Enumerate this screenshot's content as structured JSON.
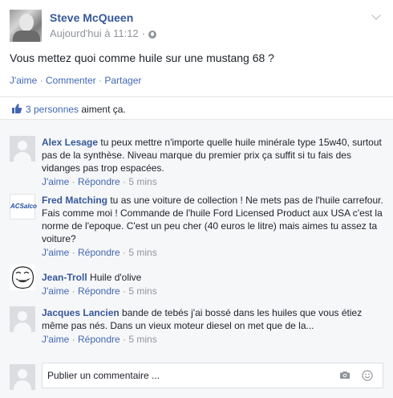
{
  "post": {
    "author": "Steve McQueen",
    "timestamp": "Aujourd'hui à 11:12",
    "separator": "·",
    "text": "Vous mettez quoi comme huile sur une mustang 68 ?",
    "actions": {
      "like": "J'aime",
      "comment": "Commenter",
      "share": "Partager",
      "sep": " · "
    },
    "likes": {
      "count_link": "3 personnes",
      "suffix": " aiment ça."
    }
  },
  "comments": [
    {
      "author": "Alex Lesage",
      "text": " tu peux mettre n'importe quelle huile minérale type 15w40, surtout pas de la synthèse. Niveau marque du premier prix ça suffit si tu fais des vidanges pas trop espacées.",
      "like": "J'aime",
      "reply": "Répondre",
      "time": "5 mins",
      "avatar": "default-avatar"
    },
    {
      "author": "Fred Matching",
      "text": " tu as une voiture de collection ! Ne mets pas de l'huile carrefour. Fais comme moi ! Commande de l'huile Ford Licensed Product aux USA c'est la norme de l'epoque. C'est un peu cher (40 euros le litre) mais aimes tu assez ta voiture?",
      "like": "J'aime",
      "reply": "Répondre",
      "time": "5 mins",
      "avatar": "logo-avatar",
      "avatar_label": "ACSalco"
    },
    {
      "author": "Jean-Troll",
      "text": " Huile d'olive",
      "like": "J'aime",
      "reply": "Répondre",
      "time": "5 mins",
      "avatar": "troll-face-avatar"
    },
    {
      "author": "Jacques Lancien",
      "text": " bande de tebés j'ai bossé dans les huiles que vous étiez même pas nés. Dans un vieux moteur diesel on met que de la...",
      "like": "J'aime",
      "reply": "Répondre",
      "time": "5 mins",
      "avatar": "default-avatar"
    }
  ],
  "composer": {
    "placeholder": "Publier un commentaire ...",
    "icons": [
      "camera-icon",
      "smiley-icon"
    ]
  },
  "colors": {
    "link": "#365899",
    "action": "#4267b2",
    "muted": "#90949c",
    "comments_bg": "#f6f7f9"
  }
}
